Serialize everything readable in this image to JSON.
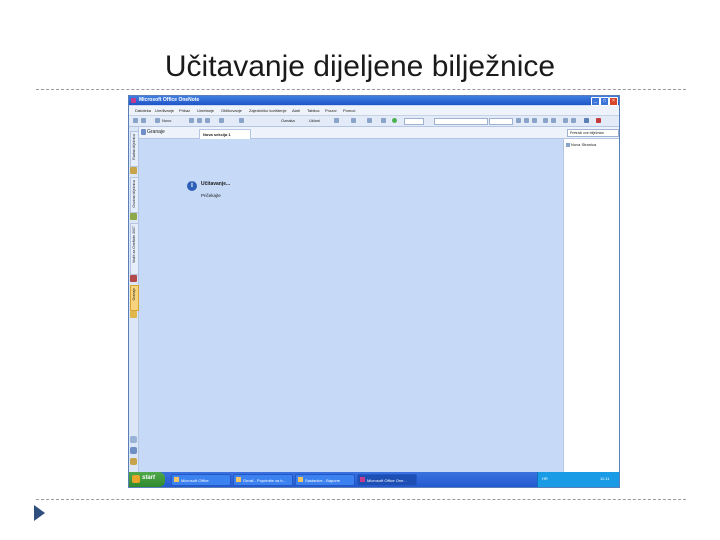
{
  "slide": {
    "title": "Učitavanje dijeljene bilježnice"
  },
  "window": {
    "title": "Microsoft Office OneNote"
  },
  "menu": [
    "Datoteka",
    "Uređivanje",
    "Prikaz",
    "Umetanje",
    "Oblikovanje",
    "Zajedničko korištenje",
    "Alati",
    "Tablica",
    "Prozor",
    "Pomoć"
  ],
  "toolbar": {
    "new_label": "Novo",
    "tag_label": "Oznaka",
    "upload_label": "Ukloni"
  },
  "navigation": {
    "tabs": [
      "Radna bilježnica",
      "Osobna bilježnica",
      "Vodič za OneNote 2007",
      "Granaje"
    ]
  },
  "notebook": {
    "name": "Granaje"
  },
  "section": {
    "tab_label": "Nova sekcija 1"
  },
  "search": {
    "placeholder": "Pretraži ove bilježnice"
  },
  "page": {
    "loading_title": "Učitavanje...",
    "loading_sub": "Pričekajte"
  },
  "pages": {
    "new_page": "Nova Stranica"
  },
  "taskbar": {
    "start": "start",
    "tasks": [
      "Microsoft Office",
      "Gmail - Poprimite za b...",
      "Sastanice - Bapone",
      "Microsoft Office One..."
    ],
    "lang": "HR",
    "time": "11:11"
  }
}
